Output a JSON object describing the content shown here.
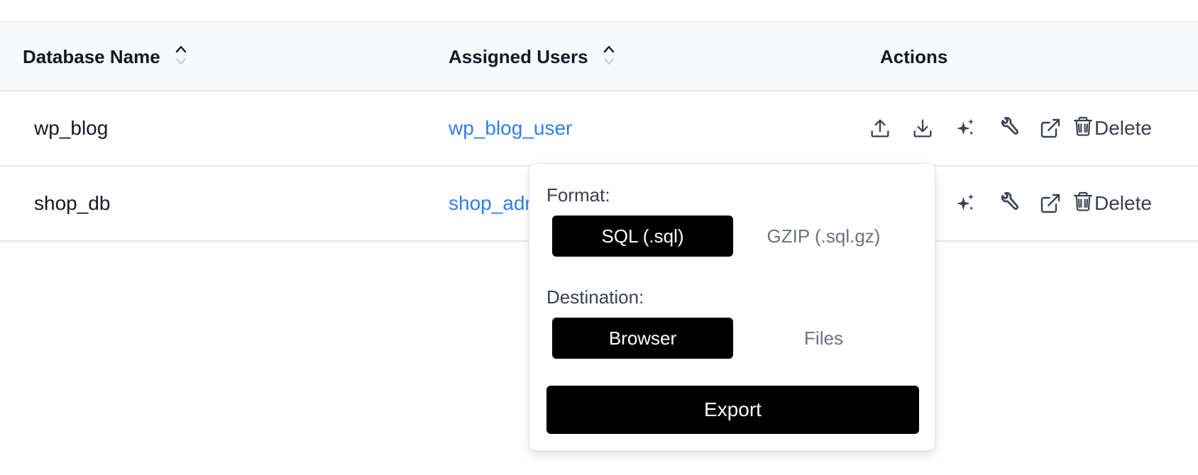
{
  "table": {
    "headers": {
      "database_name": "Database Name",
      "assigned_users": "Assigned Users",
      "actions": "Actions"
    },
    "rows": [
      {
        "name": "wp_blog",
        "user": "wp_blog_user",
        "delete_label": "Delete"
      },
      {
        "name": "shop_db",
        "user": "shop_adr",
        "delete_label": "Delete"
      }
    ],
    "action_icons": [
      "upload-icon",
      "download-icon",
      "sparkles-icon",
      "wrench-icon",
      "external-link-icon",
      "trash-icon"
    ]
  },
  "export_popover": {
    "format_label": "Format:",
    "format_options": [
      "SQL (.sql)",
      "GZIP (.sql.gz)"
    ],
    "format_selected": "SQL (.sql)",
    "destination_label": "Destination:",
    "destination_options": [
      "Browser",
      "Files"
    ],
    "destination_selected": "Browser",
    "export_label": "Export"
  },
  "colors": {
    "link": "#2f7fe9",
    "header_bg": "#f8f9fb",
    "active_segment": "#000000",
    "border": "#e5e7eb"
  }
}
